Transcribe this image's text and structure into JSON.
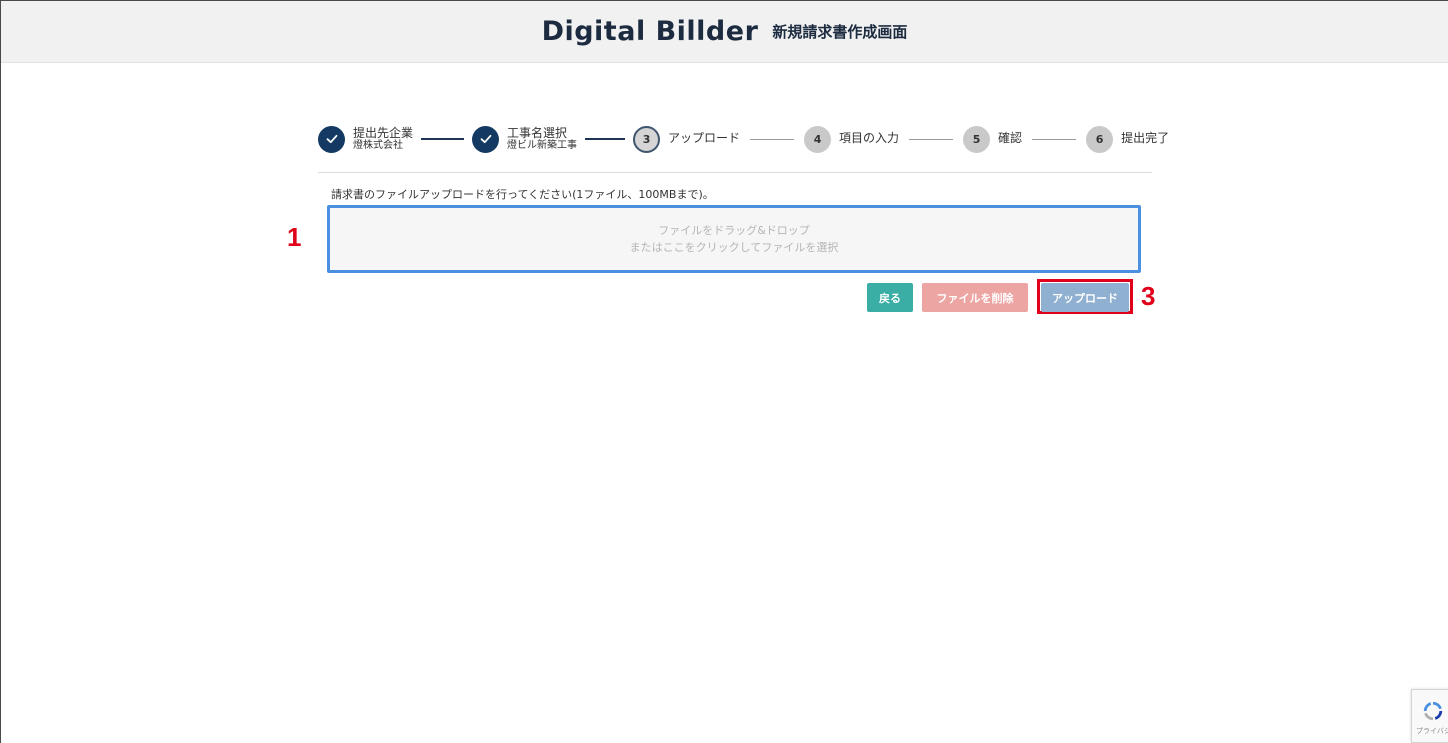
{
  "header": {
    "logo_text": "Digital Billder",
    "title": "新規請求書作成画面"
  },
  "stepper": {
    "steps": [
      {
        "number": "1",
        "label": "提出先企業",
        "sub": "燈株式会社",
        "state": "done"
      },
      {
        "number": "2",
        "label": "工事名選択",
        "sub": "燈ビル新築工事",
        "state": "done"
      },
      {
        "number": "3",
        "label": "アップロード",
        "sub": "",
        "state": "current"
      },
      {
        "number": "4",
        "label": "項目の入力",
        "sub": "",
        "state": "todo"
      },
      {
        "number": "5",
        "label": "確認",
        "sub": "",
        "state": "todo"
      },
      {
        "number": "6",
        "label": "提出完了",
        "sub": "",
        "state": "todo"
      }
    ]
  },
  "upload": {
    "instruction": "請求書のファイルアップロードを行ってください(1ファイル、100MBまで)。",
    "dropzone_line1": "ファイルをドラッグ&ドロップ",
    "dropzone_line2": "またはここをクリックしてファイルを選択"
  },
  "actions": {
    "back_label": "戻る",
    "delete_label": "ファイルを削除",
    "upload_label": "アップロード"
  },
  "annotations": {
    "marker1": "1",
    "marker3": "3"
  },
  "recaptcha": {
    "text": "プライバシー"
  },
  "colors": {
    "step_done": "#143a63",
    "dropzone_border": "#4a8fe0",
    "back_button": "#3aaea5",
    "delete_button": "#eca5a3",
    "upload_button": "#8fb0d1",
    "annotation_red": "#e0001a"
  }
}
